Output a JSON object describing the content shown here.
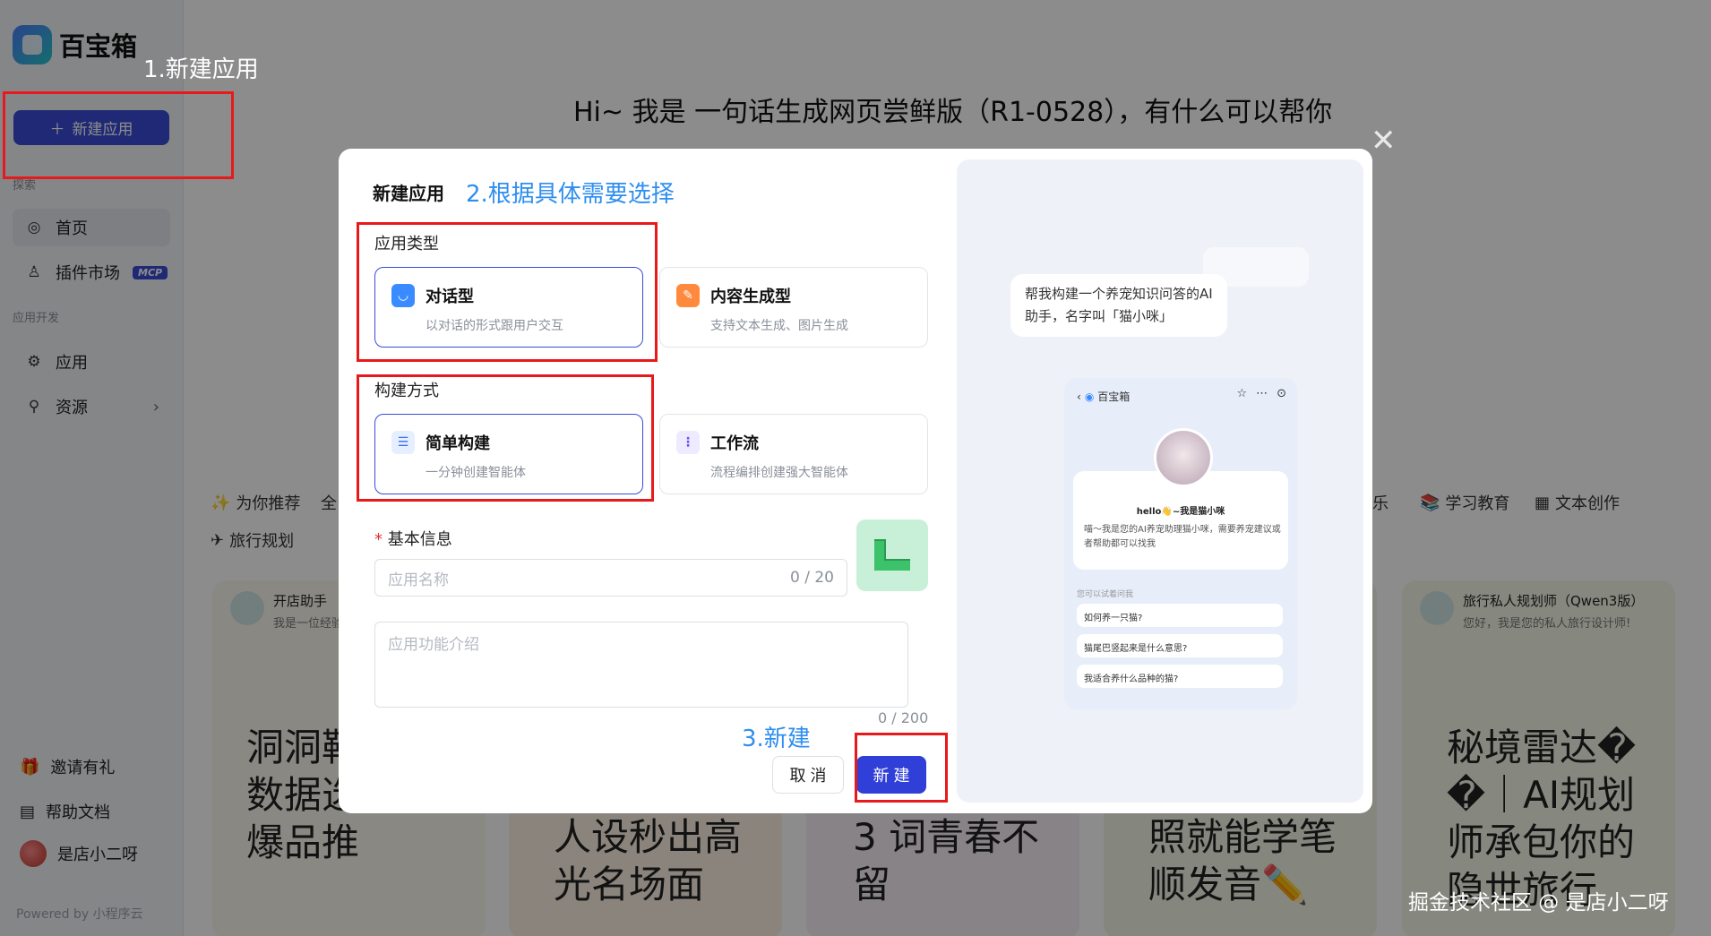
{
  "app": {
    "logo_text": "百宝箱",
    "new_app_label": "新建应用",
    "nav_group_explore": "探索",
    "nav_home": "首页",
    "nav_plugins": "插件市场",
    "mcp_badge": "MCP",
    "nav_group_dev": "应用开发",
    "nav_apps": "应用",
    "nav_resources": "资源",
    "footer_invite": "邀请有礼",
    "footer_help": "帮助文档",
    "footer_user": "是店小二呀",
    "powered": "Powered by 小程序云"
  },
  "main": {
    "greeting": "Hi~ 我是 一句话生成网页尝鲜版（R1-0528），有什么可以帮你",
    "categories": [
      "为你推荐",
      "全",
      "乐",
      "学习教育",
      "文本创作",
      "旅行规划"
    ],
    "cards": [
      {
        "title": "开店助手",
        "sub": "我是一位经验",
        "big": "洞洞鞋 t? 开 数据选址+ 爆品推"
      },
      {
        "big": "人设秒出高 光名场面"
      },
      {
        "big": "3 词青春不留"
      },
      {
        "big": "照就能学笔 顺发音✏️"
      },
      {
        "title": "旅行私人规划师（Qwen3版）",
        "sub": "您好，我是您的私人旅行设计师!",
        "big": "秘境雷达� �｜AI规划 师承包你的 隐世旅行"
      }
    ]
  },
  "modal": {
    "title": "新建应用",
    "app_type_label": "应用类型",
    "type_chat_name": "对话型",
    "type_chat_desc": "以对话的形式跟用户交互",
    "type_content_name": "内容生成型",
    "type_content_desc": "支持文本生成、图片生成",
    "build_label": "构建方式",
    "build_simple_name": "简单构建",
    "build_simple_desc": "一分钟创建智能体",
    "build_flow_name": "工作流",
    "build_flow_desc": "流程编排创建强大智能体",
    "basic_info_label": "基本信息",
    "name_placeholder": "应用名称",
    "name_count": "0 / 20",
    "intro_placeholder": "应用功能介绍",
    "intro_count": "0 / 200",
    "cancel_label": "取 消",
    "create_label": "新 建",
    "preview": {
      "bubble": "帮我构建一个养宠知识问答的AI助手，名字叫「猫小咪」",
      "phone_brand": "百宝箱",
      "hello": "hello👋~我是猫小咪",
      "intro": "喵～我是您的AI养宠助理猫小咪，需要养宠建议或者帮助都可以找我",
      "try_label": "您可以试着问我",
      "questions": [
        "如何养一只猫?",
        "猫尾巴竖起来是什么意思?",
        "我适合养什么品种的猫?"
      ]
    }
  },
  "annotations": {
    "step1": "1.新建应用",
    "step2": "2.根据具体需要选择",
    "step3": "3.新建"
  },
  "watermark": "掘金技术社区 @ 是店小二呀",
  "colors": {
    "brand": "#3a4bd6",
    "annotation_red": "#e8191b",
    "annotation_blue": "#2e8ef0"
  }
}
